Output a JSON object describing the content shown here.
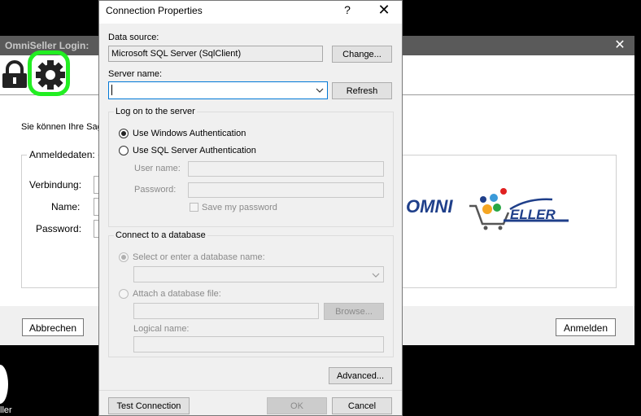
{
  "login": {
    "title": "OmniSeller Login:",
    "intro": "Sie können Ihre Sag",
    "group_label": "Anmeldedaten:",
    "labels": [
      "Verbindung:",
      "Name:",
      "Password:"
    ],
    "cancel": "Abbrechen",
    "login": "Anmelden",
    "close": "✕"
  },
  "desktop": {
    "icon_label": "ller"
  },
  "logo": {
    "left": "OMNI",
    "right": "ELLER"
  },
  "dialog": {
    "title": "Connection Properties",
    "help": "?",
    "close": "✕",
    "data_source_label": "Data source:",
    "data_source_value": "Microsoft SQL Server (SqlClient)",
    "change_btn": "Change...",
    "server_name_label": "Server name:",
    "server_name_value": "",
    "refresh_btn": "Refresh",
    "logon_group": "Log on to the server",
    "auth_windows": "Use Windows Authentication",
    "auth_sql": "Use SQL Server Authentication",
    "user_name_label": "User name:",
    "password_label": "Password:",
    "save_password": "Save my password",
    "db_group": "Connect to a database",
    "db_select": "Select or enter a database name:",
    "db_attach": "Attach a database file:",
    "browse_btn": "Browse...",
    "logical_name_label": "Logical name:",
    "advanced_btn": "Advanced...",
    "test_btn": "Test Connection",
    "ok_btn": "OK",
    "cancel_btn": "Cancel"
  },
  "colors": {
    "highlight": "#22ee22",
    "logo_blue": "#1f3f8a",
    "logo_orange": "#f5a623"
  },
  "icons": [
    "lock-icon",
    "gear-icon",
    "close-icon",
    "help-icon",
    "chevron-down-icon"
  ]
}
